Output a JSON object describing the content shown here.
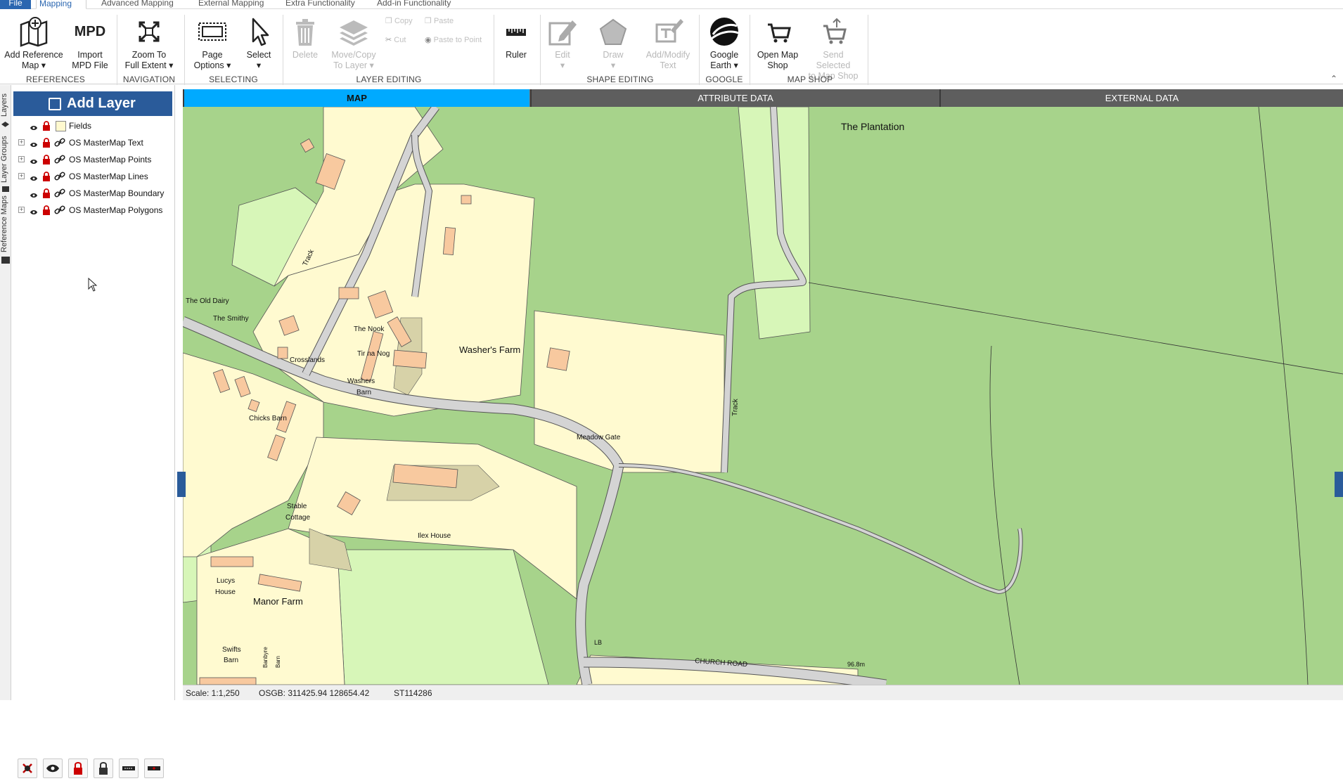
{
  "ribbon_tabs": [
    "File",
    "Mapping",
    "Advanced Mapping",
    "External Mapping",
    "Extra Functionality",
    "Add-in Functionality"
  ],
  "ribbon": {
    "add_reference_map": [
      "Add Reference",
      "Map ▾"
    ],
    "import_mpd": [
      "Import",
      "MPD File"
    ],
    "mpd_badge": "MPD",
    "zoom_full_extent": [
      "Zoom To",
      "Full Extent ▾"
    ],
    "page_options": [
      "Page",
      "Options ▾"
    ],
    "select": [
      "Select",
      "▾"
    ],
    "delete": [
      "Delete"
    ],
    "move_copy": [
      "Move/Copy",
      "To Layer ▾"
    ],
    "copy": "Copy",
    "paste": "Paste",
    "cut": "Cut",
    "paste_to_point": "Paste to Point",
    "ruler": [
      "Ruler"
    ],
    "edit": [
      "Edit",
      "▾"
    ],
    "draw": [
      "Draw",
      "▾"
    ],
    "add_modify_text": [
      "Add/Modify",
      "Text"
    ],
    "google_earth": [
      "Google",
      "Earth ▾"
    ],
    "open_map_shop": [
      "Open Map",
      "Shop"
    ],
    "send_to_map_shop": [
      "Send Selected",
      "to Map Shop"
    ],
    "groups": [
      "REFERENCES",
      "NAVIGATION",
      "SELECTING",
      "LAYER EDITING",
      "SHAPE EDITING",
      "GOOGLE",
      "MAP SHOP"
    ]
  },
  "side_tabs": [
    "Layers",
    "Layer Groups",
    "Reference Maps"
  ],
  "layer_panel": {
    "add_layer_label": "Add Layer",
    "layers": [
      {
        "name": "Fields",
        "expandable": false,
        "swatch": true
      },
      {
        "name": "OS MasterMap Text",
        "expandable": true,
        "swatch": false
      },
      {
        "name": "OS MasterMap Points",
        "expandable": true,
        "swatch": false
      },
      {
        "name": "OS MasterMap Lines",
        "expandable": true,
        "swatch": false
      },
      {
        "name": "OS MasterMap Boundary",
        "expandable": false,
        "swatch": false
      },
      {
        "name": "OS MasterMap Polygons",
        "expandable": true,
        "swatch": false
      }
    ]
  },
  "map_tabs": {
    "map": "MAP",
    "attribute": "ATTRIBUTE DATA",
    "external": "EXTERNAL DATA"
  },
  "map_labels": {
    "plantation": "The Plantation",
    "old_dairy": "The Old Dairy",
    "smithy": "The Smithy",
    "nook": "The Nook",
    "tir_na_nog": "Tir na Nog",
    "crosslands": "Crosslands",
    "washers_farm": "Washer's Farm",
    "washers_barn_1": "Washers",
    "washers_barn_2": "Barn",
    "chicks_barn": "Chicks Barn",
    "meadow_gate": "Meadow Gate",
    "stable_cottage_1": "Stable",
    "stable_cottage_2": "Cottage",
    "ilex_house": "Ilex House",
    "lucys_house_1": "Lucys",
    "lucys_house_2": "House",
    "manor_farm": "Manor Farm",
    "swifts_barn_1": "Swifts",
    "swifts_barn_2": "Barn",
    "track": "Track",
    "church_road": "CHURCH ROAD",
    "lb": "LB",
    "spot_height": "96.8m",
    "banbyre": "Banbyre",
    "barn_small": "Barn"
  },
  "status": {
    "scale": "Scale: 1:1,250",
    "osgb": "OSGB: 311425.94  128654.42",
    "grid_ref": "ST114286"
  },
  "colors": {
    "accent": "#2a5b9a",
    "active_tab": "#00aaff",
    "field": "#a7d38b",
    "light_field": "#d7f6b8",
    "plot": "#fffad0",
    "building": "#f8c99f",
    "road": "#d4d4d4"
  }
}
